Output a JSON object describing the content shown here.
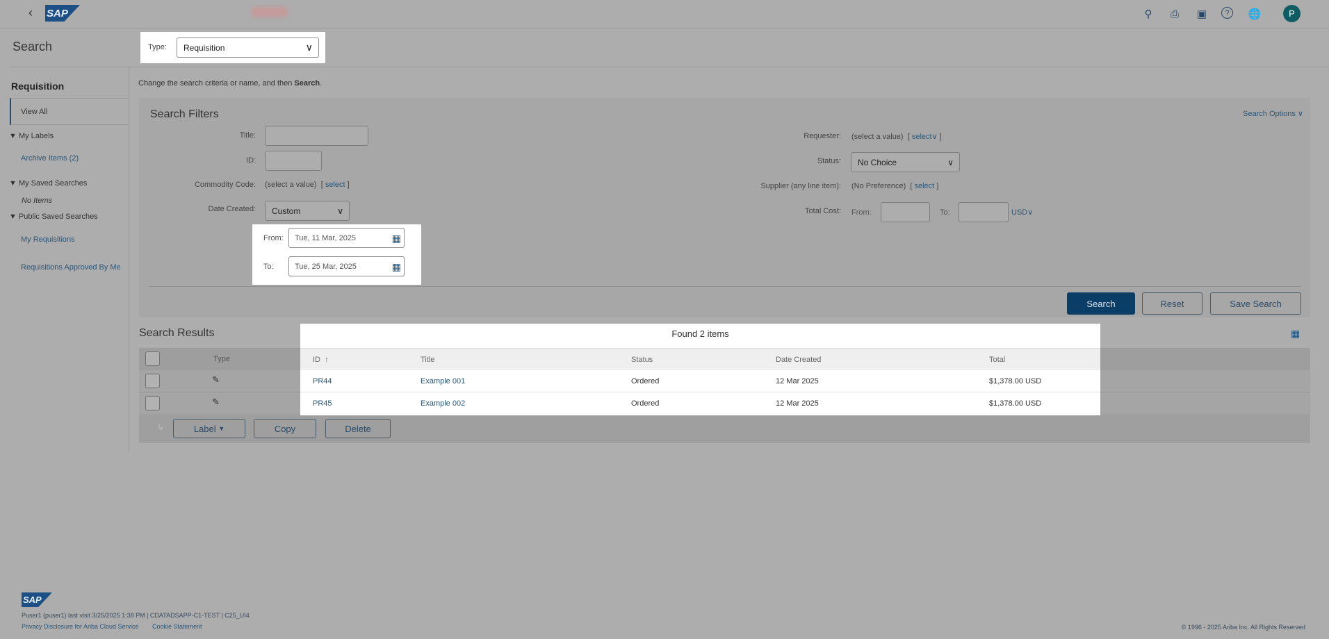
{
  "header": {
    "back": "‹",
    "logo": "SAP",
    "avatar": "P",
    "icons": [
      "search-icon",
      "print-icon",
      "chat-icon",
      "help-icon",
      "globe-icon"
    ]
  },
  "page": {
    "title": "Search",
    "type_label": "Type:",
    "type_value": "Requisition",
    "instruction_prefix": "Change the search criteria or name, and then ",
    "instruction_bold": "Search",
    "instruction_suffix": "."
  },
  "sidebar": {
    "title": "Requisition",
    "view_all": "View All",
    "my_labels": "My Labels",
    "archive_items": "Archive Items (2)",
    "my_saved": "My Saved Searches",
    "no_items": "No Items",
    "public_saved": "Public Saved Searches",
    "my_requisitions": "My Requisitions",
    "approved_by_me": "Requisitions Approved By Me"
  },
  "filters": {
    "title": "Search Filters",
    "search_options": "Search Options",
    "title_label": "Title:",
    "id_label": "ID:",
    "commodity_label": "Commodity Code:",
    "commodity_value": "(select a value)",
    "select": "select",
    "date_label": "Date Created:",
    "date_value": "Custom",
    "from_label": "From:",
    "from_value": "Tue, 11 Mar, 2025",
    "to_label": "To:",
    "to_value": "Tue, 25 Mar, 2025",
    "requester_label": "Requester:",
    "requester_value": "(select a value)",
    "status_label": "Status:",
    "status_value": "No Choice",
    "supplier_label": "Supplier (any line item):",
    "supplier_value": "(No Preference)",
    "total_label": "Total Cost:",
    "total_from": "From:",
    "total_to": "To:",
    "currency": "USD"
  },
  "buttons": {
    "search": "Search",
    "reset": "Reset",
    "save": "Save Search"
  },
  "results": {
    "title": "Search Results",
    "found": "Found 2 items",
    "columns": [
      "Type",
      "ID",
      "Title",
      "Status",
      "Date Created",
      "Total"
    ],
    "sort_arrow": "↑",
    "rows": [
      {
        "id": "PR44",
        "title": "Example 001",
        "status": "Ordered",
        "date": "12 Mar 2025",
        "total": "$1,378.00 USD"
      },
      {
        "id": "PR45",
        "title": "Example 002",
        "status": "Ordered",
        "date": "12 Mar 2025",
        "total": "$1,378.00 USD"
      }
    ],
    "actions": {
      "label": "Label",
      "copy": "Copy",
      "delete": "Delete"
    }
  },
  "footer": {
    "logo": "SAP",
    "user_line": "Puser1 (puser1) last visit 3/25/2025 1:38 PM | CDATADSAPP-C1-TEST | C25_UI4",
    "privacy": "Privacy Disclosure for Ariba Cloud Service",
    "cookie": "Cookie Statement",
    "copyright": "© 1996 - 2025 Ariba Inc. All Rights Reserved"
  }
}
